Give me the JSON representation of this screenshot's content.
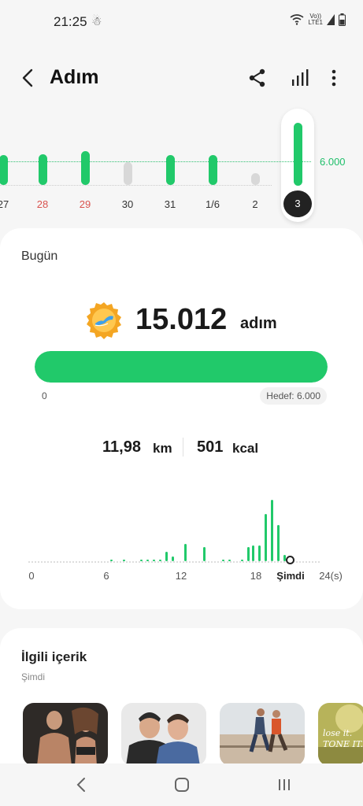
{
  "status_bar": {
    "time": "21:25",
    "network_top": "Vo))",
    "network_bottom": "LTE1"
  },
  "app_bar": {
    "title": "Adım"
  },
  "week_chart": {
    "goal_label": "6.000",
    "days": [
      {
        "label": "27",
        "steps": 7600,
        "sunday": false,
        "selected": false
      },
      {
        "label": "28",
        "steps": 7700,
        "sunday": true,
        "selected": false
      },
      {
        "label": "29",
        "steps": 8500,
        "sunday": true,
        "selected": false
      },
      {
        "label": "30",
        "steps": 5800,
        "sunday": false,
        "selected": false
      },
      {
        "label": "31",
        "steps": 7600,
        "sunday": false,
        "selected": false
      },
      {
        "label": "1/6",
        "steps": 7600,
        "sunday": false,
        "selected": false
      },
      {
        "label": "2",
        "steps": 3000,
        "sunday": false,
        "selected": false
      },
      {
        "label": "3",
        "steps": 15012,
        "sunday": false,
        "selected": true
      }
    ]
  },
  "today": {
    "label": "Bugün",
    "steps": "15.012",
    "steps_unit": "adım",
    "progress_percent": 100,
    "progress_min": "0",
    "goal_text": "Hedef: 6.000",
    "distance": "11,98",
    "distance_unit": "km",
    "calories": "501",
    "calories_unit": "kcal",
    "hour_labels": [
      "0",
      "6",
      "12",
      "18",
      "Şimdi",
      "24(s)"
    ]
  },
  "related": {
    "title": "İlgili içerik",
    "subtitle": "Şimdi",
    "thumb4_text": "lose it. TONE IT."
  },
  "colors": {
    "accent": "#21c96a",
    "sunday": "#d9534f",
    "inactive_bar": "#d8d8d8"
  }
}
